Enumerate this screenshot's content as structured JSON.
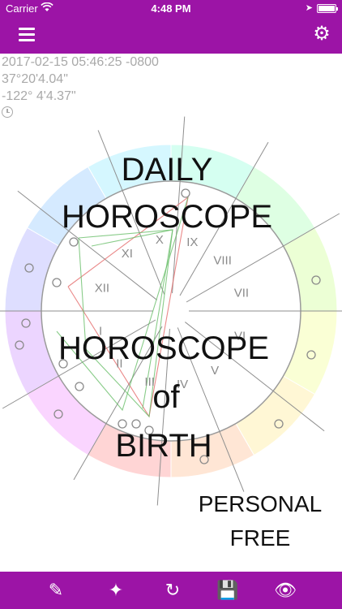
{
  "status_bar": {
    "carrier": "Carrier",
    "time": "4:48 PM",
    "icons": [
      "wifi-icon",
      "location-arrow-icon",
      "battery-icon"
    ]
  },
  "nav_bar": {
    "background_color": "#9c14a6",
    "left_icon": "hamburger-menu-icon",
    "right_icon": "gear-icon"
  },
  "chart_info": {
    "datetime": "2017-02-15 05:46:25 -0800",
    "latitude": "37°20'4.04\"",
    "longitude": "-122° 4'4.37\"",
    "icon": "clock-icon"
  },
  "wheel": {
    "houses": [
      "I",
      "II",
      "III",
      "IV",
      "V",
      "VI",
      "VII",
      "VIII",
      "IX",
      "X",
      "XI",
      "XII"
    ],
    "sign_colors": [
      "#ffb3b3",
      "#ffd1b3",
      "#fff0b3",
      "#f6ffb3",
      "#dcffb3",
      "#c2ffcc",
      "#b3ffe6",
      "#b3f0ff",
      "#b3d9ff",
      "#c2c2ff",
      "#dcb3ff",
      "#f6b3ff"
    ]
  },
  "promo": {
    "line1": "DAILY",
    "line2": "HOROSCOPE",
    "line3": "HOROSCOPE",
    "line4": "of",
    "line5": "BIRTH",
    "line6": "PERSONAL",
    "line7": "FREE"
  },
  "toolbar": {
    "icons": [
      "edit-icon",
      "magic-wand-icon",
      "refresh-icon",
      "save-icon",
      "eye-icon"
    ]
  }
}
